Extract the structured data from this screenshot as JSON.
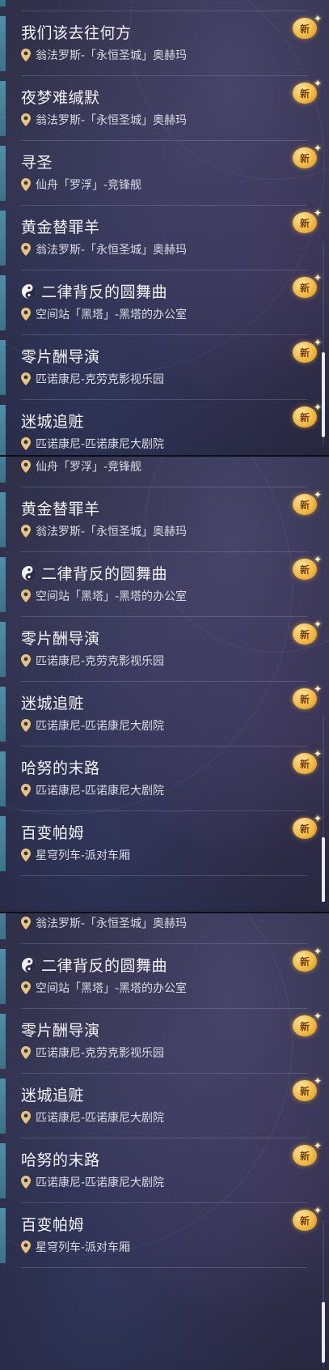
{
  "new_badge_label": "新",
  "panel1": {
    "quests": [
      {
        "title": "我们该去往何方",
        "location": "翁法罗斯-「永恒圣城」奥赫玛",
        "icon": null
      },
      {
        "title": "夜梦难缄默",
        "location": "翁法罗斯-「永恒圣城」奥赫玛",
        "icon": null
      },
      {
        "title": "寻圣",
        "location": "仙舟「罗浮」-竞锋舰",
        "icon": null
      },
      {
        "title": "黄金替罪羊",
        "location": "翁法罗斯-「永恒圣城」奥赫玛",
        "icon": null
      },
      {
        "title": "二律背反的圆舞曲",
        "location": "空间站「黑塔」-黑塔的办公室",
        "icon": "yin-yang-icon"
      },
      {
        "title": "零片酬导演",
        "location": "匹诺康尼-克劳克影视乐园",
        "icon": null
      },
      {
        "title": "迷城追赃",
        "location": "匹诺康尼-匹诺康尼大剧院",
        "icon": null
      }
    ]
  },
  "panel2": {
    "top_partial_location": "仙舟「罗浮」-竞锋舰",
    "quests": [
      {
        "title": "黄金替罪羊",
        "location": "翁法罗斯-「永恒圣城」奥赫玛",
        "icon": null
      },
      {
        "title": "二律背反的圆舞曲",
        "location": "空间站「黑塔」-黑塔的办公室",
        "icon": "yin-yang-icon"
      },
      {
        "title": "零片酬导演",
        "location": "匹诺康尼-克劳克影视乐园",
        "icon": null
      },
      {
        "title": "迷城追赃",
        "location": "匹诺康尼-匹诺康尼大剧院",
        "icon": null
      },
      {
        "title": "哈努的末路",
        "location": "匹诺康尼-匹诺康尼大剧院",
        "icon": null
      },
      {
        "title": "百变帕姆",
        "location": "星穹列车-派对车厢",
        "icon": null
      }
    ]
  },
  "panel3": {
    "top_partial_location": "翁法罗斯-「永恒圣城」奥赫玛",
    "quests": [
      {
        "title": "二律背反的圆舞曲",
        "location": "空间站「黑塔」-黑塔的办公室",
        "icon": "yin-yang-icon"
      },
      {
        "title": "零片酬导演",
        "location": "匹诺康尼-克劳克影视乐园",
        "icon": null
      },
      {
        "title": "迷城追赃",
        "location": "匹诺康尼-匹诺康尼大剧院",
        "icon": null
      },
      {
        "title": "哈努的末路",
        "location": "匹诺康尼-匹诺康尼大剧院",
        "icon": null
      },
      {
        "title": "百变帕姆",
        "location": "星穹列车-派对车厢",
        "icon": null
      }
    ]
  },
  "colors": {
    "accent_bar": "#4f8fa6",
    "badge_gold": "#f0b43a",
    "pin_gold": "#e7c47c",
    "title_text": "#f3f3f6"
  }
}
